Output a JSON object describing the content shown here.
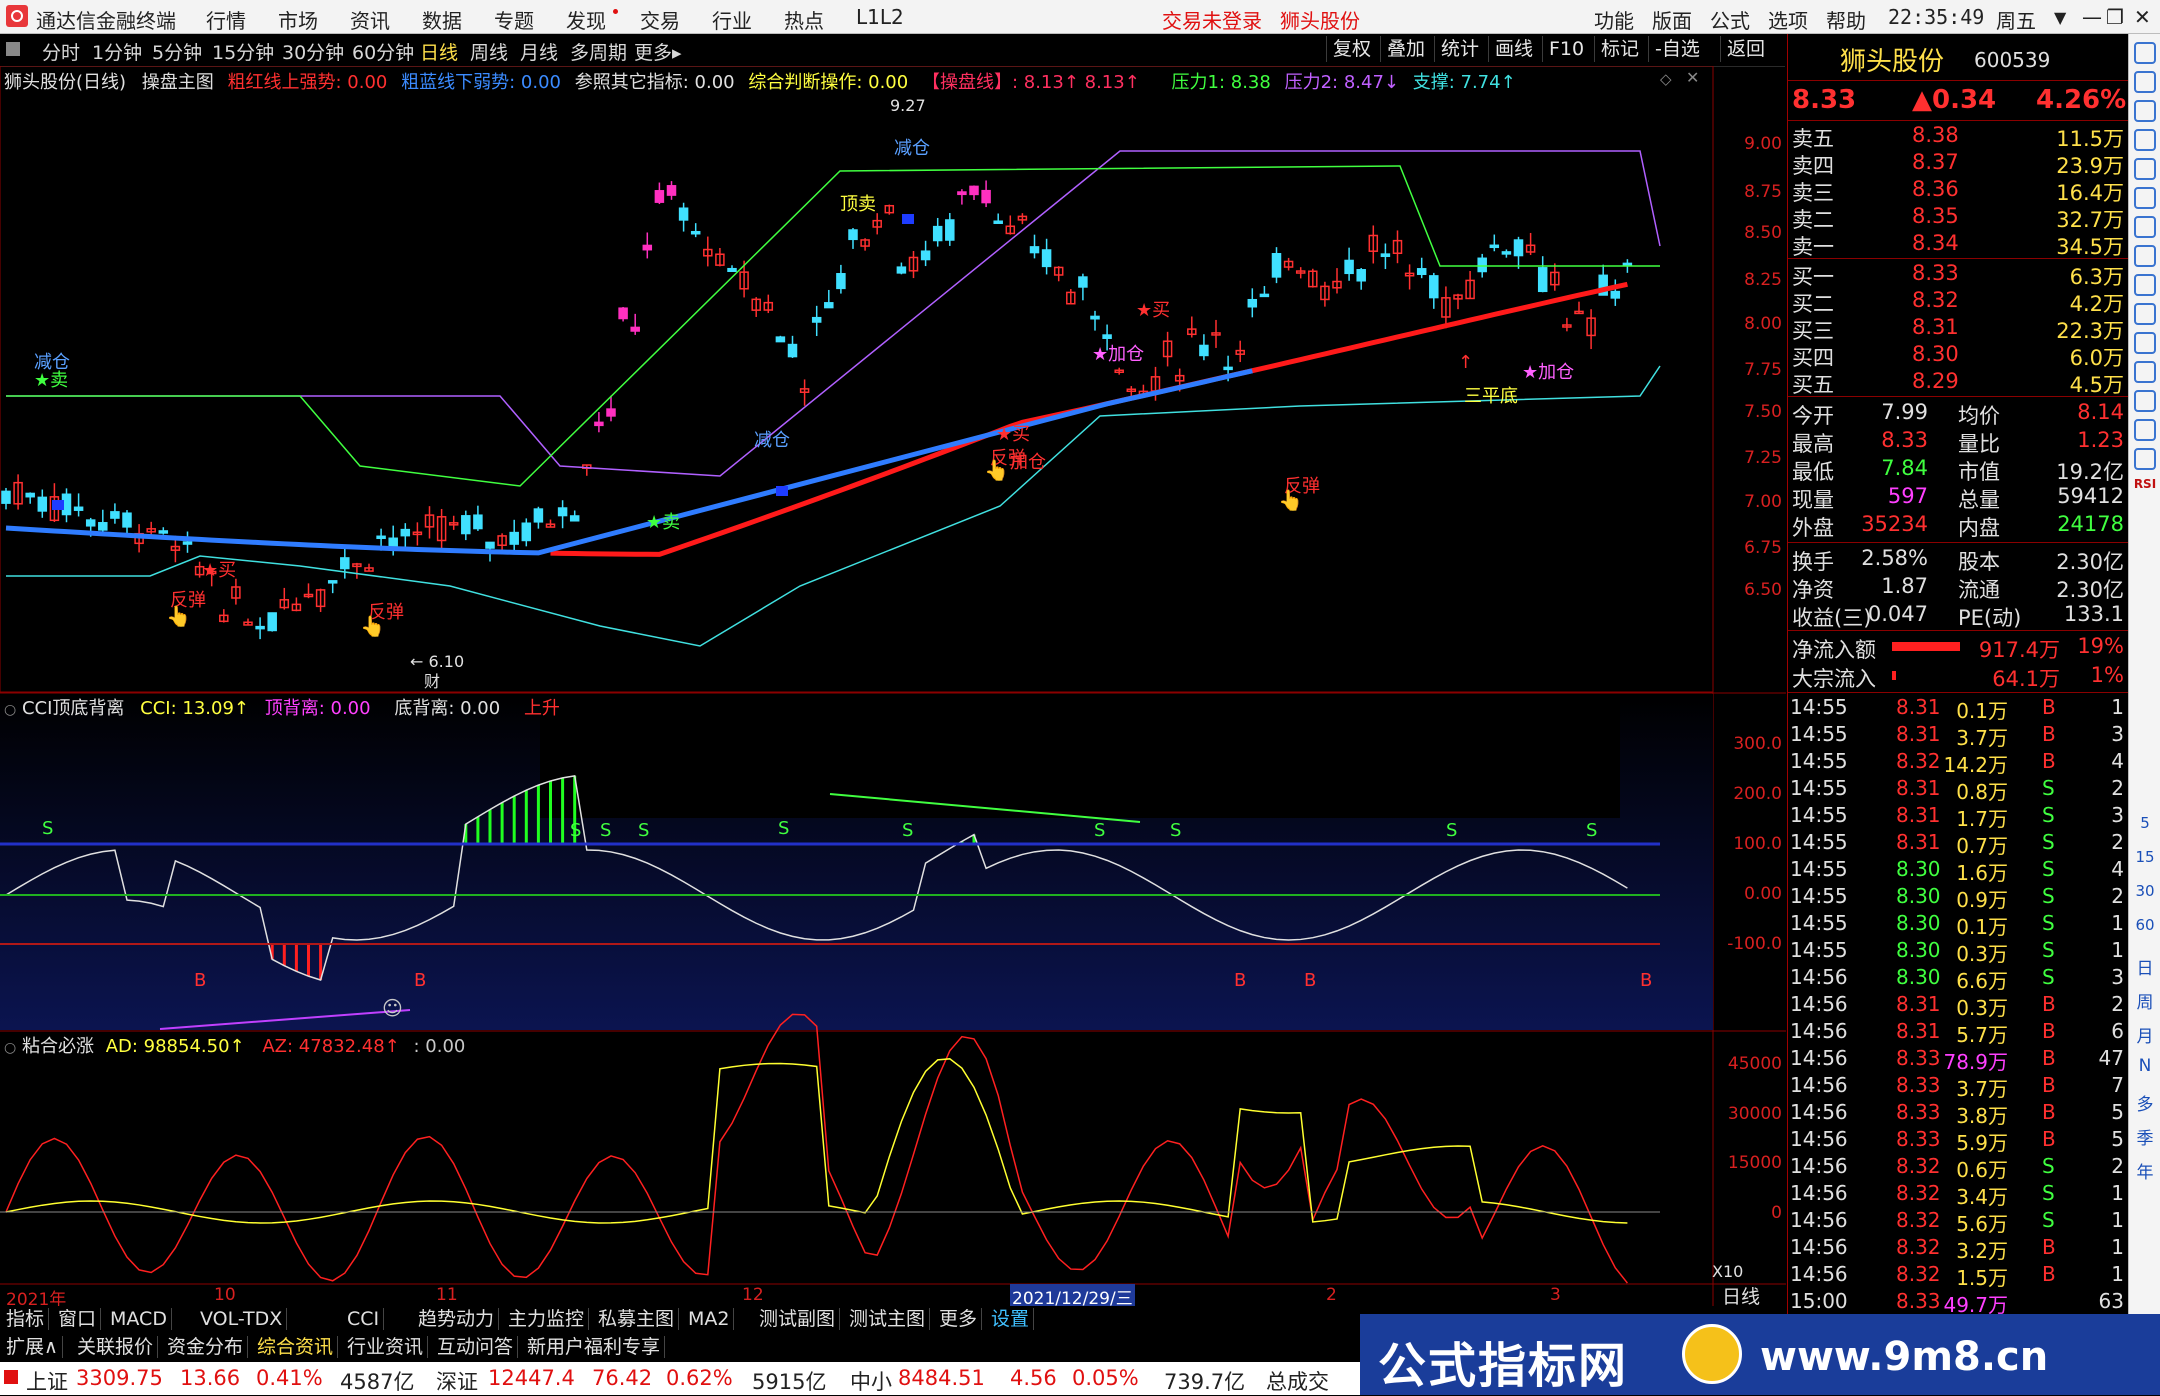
{
  "menu": {
    "app_title": "通达信金融终端",
    "items": [
      "行情",
      "市场",
      "资讯",
      "数据",
      "专题",
      "发现",
      "交易",
      "行业",
      "热点",
      "L1L2"
    ],
    "login": "交易未登录",
    "stock_name": "狮头股份",
    "right_items": [
      "功能",
      "版面",
      "公式",
      "选项",
      "帮助"
    ],
    "time": "22:35:49",
    "weekday": "周五"
  },
  "toolbar": {
    "periods": [
      "分时",
      "1分钟",
      "5分钟",
      "15分钟",
      "30分钟",
      "60分钟",
      "日线",
      "周线",
      "月线",
      "多周期",
      "更多▸"
    ],
    "active": "日线",
    "right_buttons": [
      "复权",
      "叠加",
      "统计",
      "画线",
      "F10",
      "标记",
      "-自选",
      "返回"
    ]
  },
  "main_pane": {
    "title": "狮头股份(日线)",
    "indicator": "操盘主图",
    "legend": [
      {
        "label": "粗红线上强势: 0.00",
        "color": "#ff3030"
      },
      {
        "label": "粗蓝线下弱势: 0.00",
        "color": "#3b8bff"
      },
      {
        "label": "参照其它指标: 0.00",
        "color": "#e0e0e0"
      },
      {
        "label": "综合判断操作: 0.00",
        "color": "#ffff40"
      },
      {
        "label": "【操盘线】: 8.13↑ 8.13↑",
        "color": "#ff3060"
      },
      {
        "label": "压力1: 8.38",
        "color": "#40ff40"
      },
      {
        "label": "压力2: 8.47↓",
        "color": "#c060ff"
      },
      {
        "label": "支撑: 7.74↑",
        "color": "#40e0e0"
      }
    ],
    "y_ticks": [
      "9.00",
      "8.75",
      "8.50",
      "8.25",
      "8.00",
      "7.75",
      "7.50",
      "7.25",
      "7.00",
      "6.75",
      "6.50"
    ],
    "annotations": [
      {
        "text": "减仓",
        "color": "#5aa0ff"
      },
      {
        "text": "★卖",
        "color": "#40ff40"
      },
      {
        "text": "反弹",
        "color": "#ff3030"
      },
      {
        "text": "★买",
        "color": "#ff3030"
      },
      {
        "text": "反弹",
        "color": "#ff3030"
      },
      {
        "text": "← 6.10",
        "color": "#e0e0e0"
      },
      {
        "text": "财",
        "color": "#e0e0e0"
      },
      {
        "text": "★卖",
        "color": "#40ff40"
      },
      {
        "text": "减仓",
        "color": "#5aa0ff"
      },
      {
        "text": "顶卖",
        "color": "#ffff40"
      },
      {
        "text": "9.27",
        "color": "#e0e0e0"
      },
      {
        "text": "减仓",
        "color": "#5aa0ff"
      },
      {
        "text": "★买",
        "color": "#ff3030"
      },
      {
        "text": "反弹",
        "color": "#ff3030"
      },
      {
        "text": "加仓",
        "color": "#ff3030"
      },
      {
        "text": "★加仓",
        "color": "#ff60ff"
      },
      {
        "text": "★买",
        "color": "#ff3030"
      },
      {
        "text": "反弹",
        "color": "#ff3030"
      },
      {
        "text": "三平底",
        "color": "#ffff40"
      },
      {
        "text": "★加仓",
        "color": "#ff60ff"
      }
    ]
  },
  "cci_pane": {
    "title": "CCI顶底背离",
    "legend": [
      {
        "label": "CCI: 13.09↑",
        "color": "#ffff40"
      },
      {
        "label": "顶背离: 0.00",
        "color": "#ff40ff"
      },
      {
        "label": "底背离: 0.00",
        "color": "#e0e0e0"
      },
      {
        "label": "上升",
        "color": "#ff3030"
      }
    ],
    "y_ticks": [
      "300.0",
      "200.0",
      "100.0",
      "0.00",
      "-100.0"
    ],
    "signals": [
      "S",
      "S",
      "S",
      "S",
      "S",
      "S",
      "S",
      "S",
      "S",
      "S",
      "S",
      "B",
      "B",
      "B",
      "B",
      "B"
    ]
  },
  "ad_pane": {
    "title": "粘合必涨",
    "legend": [
      {
        "label": "AD: 98854.50↑",
        "color": "#ffff40"
      },
      {
        "label": "AZ: 47832.48↑",
        "color": "#ff3030"
      },
      {
        "label": ": 0.00",
        "color": "#c8c8c8"
      }
    ],
    "y_ticks": [
      "45000",
      "30000",
      "15000",
      "0"
    ],
    "x_mult": "X10"
  },
  "x_axis": {
    "labels": [
      "2021年",
      "10",
      "11",
      "12",
      "2021/12/29/三",
      "2",
      "3"
    ],
    "period": "日线"
  },
  "quote": {
    "name": "狮头股份",
    "code": "600539",
    "price": "8.33",
    "change": "▲0.34",
    "pct": "4.26%",
    "asks": [
      {
        "label": "卖五",
        "price": "8.38",
        "vol": "11.5万"
      },
      {
        "label": "卖四",
        "price": "8.37",
        "vol": "23.9万"
      },
      {
        "label": "卖三",
        "price": "8.36",
        "vol": "16.4万"
      },
      {
        "label": "卖二",
        "price": "8.35",
        "vol": "32.7万"
      },
      {
        "label": "卖一",
        "price": "8.34",
        "vol": "34.5万"
      }
    ],
    "bids": [
      {
        "label": "买一",
        "price": "8.33",
        "vol": "6.3万"
      },
      {
        "label": "买二",
        "price": "8.32",
        "vol": "4.2万"
      },
      {
        "label": "买三",
        "price": "8.31",
        "vol": "22.3万"
      },
      {
        "label": "买四",
        "price": "8.30",
        "vol": "6.0万"
      },
      {
        "label": "买五",
        "price": "8.29",
        "vol": "4.5万"
      }
    ],
    "stats": [
      {
        "l1": "今开",
        "v1": "7.99",
        "c1": "#e0e0e0",
        "l2": "均价",
        "v2": "8.14",
        "c2": "#ff3030"
      },
      {
        "l1": "最高",
        "v1": "8.33",
        "c1": "#ff3030",
        "l2": "量比",
        "v2": "1.23",
        "c2": "#ff3030"
      },
      {
        "l1": "最低",
        "v1": "7.84",
        "c1": "#40ff40",
        "l2": "市值",
        "v2": "19.2亿",
        "c2": "#e0e0e0"
      },
      {
        "l1": "现量",
        "v1": "597",
        "c1": "#ff40ff",
        "l2": "总量",
        "v2": "59412",
        "c2": "#e0e0e0"
      },
      {
        "l1": "外盘",
        "v1": "35234",
        "c1": "#ff3030",
        "l2": "内盘",
        "v2": "24178",
        "c2": "#40ff40"
      }
    ],
    "stats2": [
      {
        "l1": "换手",
        "v1": "2.58%",
        "l2": "股本",
        "v2": "2.30亿"
      },
      {
        "l1": "净资",
        "v1": "1.87",
        "l2": "流通",
        "v2": "2.30亿"
      },
      {
        "l1": "收益(三)",
        "v1": "0.047",
        "l2": "PE(动)",
        "v2": "133.1"
      }
    ],
    "flows": [
      {
        "label": "净流入额",
        "value": "917.4万",
        "pct": "19%",
        "bar": 0.75
      },
      {
        "label": "大宗流入",
        "value": "64.1万",
        "pct": "1%",
        "bar": 0.04
      }
    ],
    "ticks": [
      {
        "t": "14:55",
        "p": "8.31",
        "v": "0.1万",
        "s": "B",
        "n": "1"
      },
      {
        "t": "14:55",
        "p": "8.31",
        "v": "3.7万",
        "s": "B",
        "n": "3"
      },
      {
        "t": "14:55",
        "p": "8.32",
        "v": "14.2万",
        "s": "B",
        "n": "4"
      },
      {
        "t": "14:55",
        "p": "8.31",
        "v": "0.8万",
        "s": "S",
        "n": "2"
      },
      {
        "t": "14:55",
        "p": "8.31",
        "v": "1.7万",
        "s": "S",
        "n": "3"
      },
      {
        "t": "14:55",
        "p": "8.31",
        "v": "0.7万",
        "s": "S",
        "n": "2"
      },
      {
        "t": "14:55",
        "p": "8.30",
        "v": "1.6万",
        "s": "S",
        "n": "4"
      },
      {
        "t": "14:55",
        "p": "8.30",
        "v": "0.9万",
        "s": "S",
        "n": "2"
      },
      {
        "t": "14:55",
        "p": "8.30",
        "v": "0.1万",
        "s": "S",
        "n": "1"
      },
      {
        "t": "14:55",
        "p": "8.30",
        "v": "0.3万",
        "s": "S",
        "n": "1"
      },
      {
        "t": "14:56",
        "p": "8.30",
        "v": "6.6万",
        "s": "S",
        "n": "3"
      },
      {
        "t": "14:56",
        "p": "8.31",
        "v": "0.3万",
        "s": "B",
        "n": "2"
      },
      {
        "t": "14:56",
        "p": "8.31",
        "v": "5.7万",
        "s": "B",
        "n": "6"
      },
      {
        "t": "14:56",
        "p": "8.33",
        "v": "78.9万",
        "s": "B",
        "n": "47"
      },
      {
        "t": "14:56",
        "p": "8.33",
        "v": "3.7万",
        "s": "B",
        "n": "7"
      },
      {
        "t": "14:56",
        "p": "8.33",
        "v": "3.8万",
        "s": "B",
        "n": "5"
      },
      {
        "t": "14:56",
        "p": "8.33",
        "v": "5.9万",
        "s": "B",
        "n": "5"
      },
      {
        "t": "14:56",
        "p": "8.32",
        "v": "0.6万",
        "s": "S",
        "n": "2"
      },
      {
        "t": "14:56",
        "p": "8.32",
        "v": "3.4万",
        "s": "S",
        "n": "1"
      },
      {
        "t": "14:56",
        "p": "8.32",
        "v": "5.6万",
        "s": "S",
        "n": "1"
      },
      {
        "t": "14:56",
        "p": "8.32",
        "v": "3.2万",
        "s": "B",
        "n": "1"
      },
      {
        "t": "14:56",
        "p": "8.32",
        "v": "1.5万",
        "s": "B",
        "n": "1"
      },
      {
        "t": "15:00",
        "p": "8.33",
        "v": "49.7万",
        "s": "",
        "n": "63"
      }
    ]
  },
  "side_strip": {
    "labels": [
      "日",
      "周",
      "月",
      "N",
      "多",
      "季",
      "年"
    ],
    "icons": [
      "back-icon",
      "list-icon",
      "grid-icon",
      "chart-icon",
      "candle-icon",
      "f10-icon",
      "zoom-icon",
      "bar-icon",
      "rsi-icon",
      "lock-icon",
      "move-icon",
      "pen-icon",
      "text-icon",
      "tag-icon",
      "num-icon"
    ],
    "numbers": [
      "5",
      "15",
      "30",
      "60"
    ],
    "rsi": "RSI"
  },
  "tabs1": [
    "指标",
    "窗口",
    "MACD",
    "VOL-TDX",
    "CCI",
    "趋势动力",
    "主力监控",
    "私募主图",
    "MA2",
    "测试副图",
    "测试主图",
    "更多",
    "设置"
  ],
  "tabs2": [
    "扩展∧",
    "关联报价",
    "资金分布",
    "综合资讯",
    "行业资讯",
    "互动问答",
    "新用户福利专享"
  ],
  "status": {
    "sh_label": "上证",
    "sh_value": "3309.75",
    "sh_chg": "13.66",
    "sh_pct": "0.41%",
    "sh_amt": "4587亿",
    "sz_label": "深证",
    "sz_value": "12447.4",
    "sz_chg": "76.42",
    "sz_pct": "0.62%",
    "sz_amt": "5915亿",
    "zx_label": "中小",
    "zx_value": "8484.51",
    "zx_chg": "4.56",
    "zx_pct": "0.05%",
    "zx_amt": "739.7亿",
    "total_label": "总成交"
  },
  "banner": {
    "text": "公式指标网",
    "url": "www.9m8.cn"
  }
}
